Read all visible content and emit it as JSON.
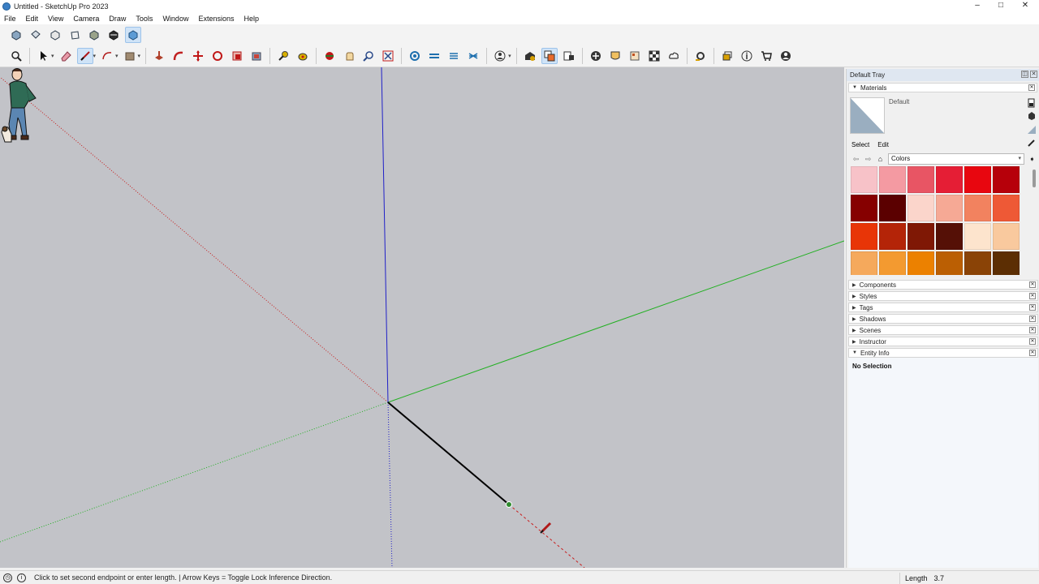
{
  "window": {
    "title": "Untitled - SketchUp Pro 2023",
    "controls": [
      "–",
      "□",
      "✕"
    ]
  },
  "menu": [
    "File",
    "Edit",
    "View",
    "Camera",
    "Draw",
    "Tools",
    "Window",
    "Extensions",
    "Help"
  ],
  "toolbar1": {
    "icons": [
      "iso-view-icon",
      "top-view-icon",
      "front-view-icon",
      "right-view-icon",
      "back-view-icon",
      "shaded-view-icon",
      "textured-view-icon"
    ],
    "active": "textured-view-icon"
  },
  "toolbar2": {
    "active_tool": "line-tool-icon",
    "icons": [
      "search-icon",
      "select-tool-icon",
      "eraser-icon",
      "line-tool-icon",
      "arc-tool-icon",
      "rectangle-tool-icon",
      "push-pull-icon",
      "follow-me-icon",
      "move-icon",
      "rotate-icon",
      "scale-icon",
      "offset-icon",
      "tape-measure-icon",
      "paint-bucket-icon",
      "orbit-icon",
      "pan-icon",
      "zoom-icon",
      "zoom-extents-icon",
      "section-plane-icon",
      "section-cut-icon",
      "section-fill-icon",
      "section-display-icon",
      "user-account-icon",
      "warehouse-icon",
      "extension-manager-icon",
      "layout-icon",
      "add-location-icon",
      "photo-texture-icon",
      "model-info-icon",
      "match-photo-icon",
      "trimble-connect-icon",
      "settings-icon",
      "scenes-icon",
      "info-icon",
      "extension-warehouse-icon",
      "profile-icon"
    ]
  },
  "tray": {
    "title": "Default Tray",
    "materials": {
      "header": "Materials",
      "current_name": "Default",
      "tabs": [
        "Select",
        "Edit"
      ],
      "library": "Colors",
      "swatches": [
        "#f7c2c8",
        "#f49aa2",
        "#e85564",
        "#e51e35",
        "#e8060f",
        "#b6000a",
        "#860000",
        "#5b0000",
        "#fbd5cb",
        "#f6a995",
        "#f2825f",
        "#ee5936",
        "#e83507",
        "#b42408",
        "#7f1805",
        "#551006",
        "#fde4cd",
        "#f9c99e",
        "#f5a95c",
        "#f39a30",
        "#ec8100",
        "#bb5f03",
        "#8a4306",
        "#5c2e03"
      ]
    },
    "panels": [
      "Components",
      "Styles",
      "Tags",
      "Shadows",
      "Scenes",
      "Instructor",
      "Entity Info"
    ],
    "entity_info": {
      "text": "No Selection"
    }
  },
  "status": {
    "message": "Click to set second endpoint or enter length. | Arrow Keys = Toggle Lock Inference Direction.",
    "vcb_label": "Length",
    "vcb_value": "3.7"
  },
  "colors": {
    "viewport_bg": "#c2c3c8",
    "red_axis": "#c81e1e",
    "green_axis": "#22b022",
    "blue_axis": "#2020c8",
    "drawn_line": "#000000",
    "tray_header": "#dfe7f1"
  }
}
